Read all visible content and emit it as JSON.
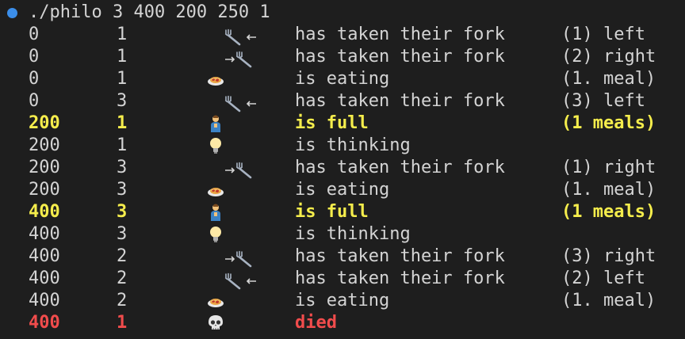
{
  "terminal": {
    "command": "./philo 3 400 200 250 1",
    "prompt_color": "#3b8eea",
    "rows": [
      {
        "time": "0",
        "id": "1",
        "icon": "fork-left-icon",
        "action": "has taken their fork",
        "detail": "(1) left",
        "style": "normal"
      },
      {
        "time": "0",
        "id": "1",
        "icon": "fork-right-icon",
        "action": "has taken their fork",
        "detail": "(2) right",
        "style": "normal"
      },
      {
        "time": "0",
        "id": "1",
        "icon": "spaghetti-icon",
        "action": "is eating",
        "detail": "(1. meal)",
        "style": "normal"
      },
      {
        "time": "0",
        "id": "3",
        "icon": "fork-left-icon",
        "action": "has taken their fork",
        "detail": "(3) left",
        "style": "normal"
      },
      {
        "time": "200",
        "id": "1",
        "icon": "person-icon",
        "action": "is full",
        "detail": "(1 meals)",
        "style": "full"
      },
      {
        "time": "200",
        "id": "1",
        "icon": "lightbulb-icon",
        "action": "is thinking",
        "detail": "",
        "style": "normal"
      },
      {
        "time": "200",
        "id": "3",
        "icon": "fork-right-icon",
        "action": "has taken their fork",
        "detail": "(1) right",
        "style": "normal"
      },
      {
        "time": "200",
        "id": "3",
        "icon": "spaghetti-icon",
        "action": "is eating",
        "detail": "(1. meal)",
        "style": "normal"
      },
      {
        "time": "400",
        "id": "3",
        "icon": "person-icon",
        "action": "is full",
        "detail": "(1 meals)",
        "style": "full"
      },
      {
        "time": "400",
        "id": "3",
        "icon": "lightbulb-icon",
        "action": "is thinking",
        "detail": "",
        "style": "normal"
      },
      {
        "time": "400",
        "id": "2",
        "icon": "fork-right-icon",
        "action": "has taken their fork",
        "detail": "(3) right",
        "style": "normal"
      },
      {
        "time": "400",
        "id": "2",
        "icon": "fork-left-icon",
        "action": "has taken their fork",
        "detail": "(2) left",
        "style": "normal"
      },
      {
        "time": "400",
        "id": "2",
        "icon": "spaghetti-icon",
        "action": "is eating",
        "detail": "(1. meal)",
        "style": "normal"
      },
      {
        "time": "400",
        "id": "1",
        "icon": "skull-icon",
        "action": "died",
        "detail": "",
        "style": "died"
      }
    ]
  },
  "colors": {
    "background": "#1e1e1e",
    "text": "#d4d4d4",
    "full": "#f5ed4c",
    "died": "#f14c4c"
  }
}
